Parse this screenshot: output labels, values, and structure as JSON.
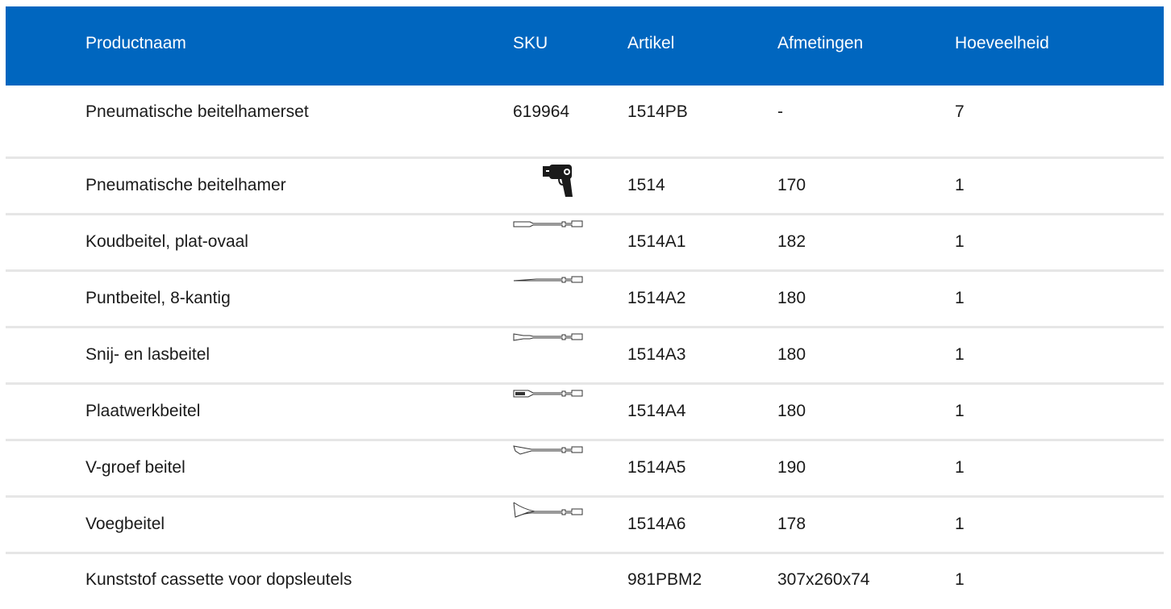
{
  "table": {
    "headers": [
      "Productnaam",
      "SKU",
      "Artikel",
      "Afmetingen",
      "Hoeveelheid"
    ],
    "rows": [
      {
        "name": "Pneumatische beitelhamerset",
        "sku": "619964",
        "artikel": "1514PB",
        "afmetingen": "-",
        "hoeveelheid": "7"
      },
      {
        "name": "Pneumatische beitelhamer",
        "icon": "air-hammer-icon",
        "artikel": "1514",
        "afmetingen": "170",
        "hoeveelheid": "1"
      },
      {
        "name": "Koudbeitel, plat-ovaal",
        "icon": "flat-chisel-icon",
        "artikel": "1514A1",
        "afmetingen": "182",
        "hoeveelheid": "1"
      },
      {
        "name": "Puntbeitel, 8-kantig",
        "icon": "point-chisel-icon",
        "artikel": "1514A2",
        "afmetingen": "180",
        "hoeveelheid": "1"
      },
      {
        "name": "Snij- en lasbeitel",
        "icon": "cutting-chisel-icon",
        "artikel": "1514A3",
        "afmetingen": "180",
        "hoeveelheid": "1"
      },
      {
        "name": "Plaatwerkbeitel",
        "icon": "sheet-metal-chisel-icon",
        "artikel": "1514A4",
        "afmetingen": "180",
        "hoeveelheid": "1"
      },
      {
        "name": "V-groef beitel",
        "icon": "v-groove-chisel-icon",
        "artikel": "1514A5",
        "afmetingen": "190",
        "hoeveelheid": "1"
      },
      {
        "name": "Voegbeitel",
        "icon": "joint-chisel-icon",
        "artikel": "1514A6",
        "afmetingen": "178",
        "hoeveelheid": "1"
      },
      {
        "name": "Kunststof cassette voor dopsleutels",
        "artikel": "981PBM2",
        "afmetingen": "307x260x74",
        "hoeveelheid": "1"
      }
    ]
  },
  "colors": {
    "header_bg": "#0066bf",
    "header_text": "#ffffff",
    "row_divider": "#e6e6e6"
  }
}
